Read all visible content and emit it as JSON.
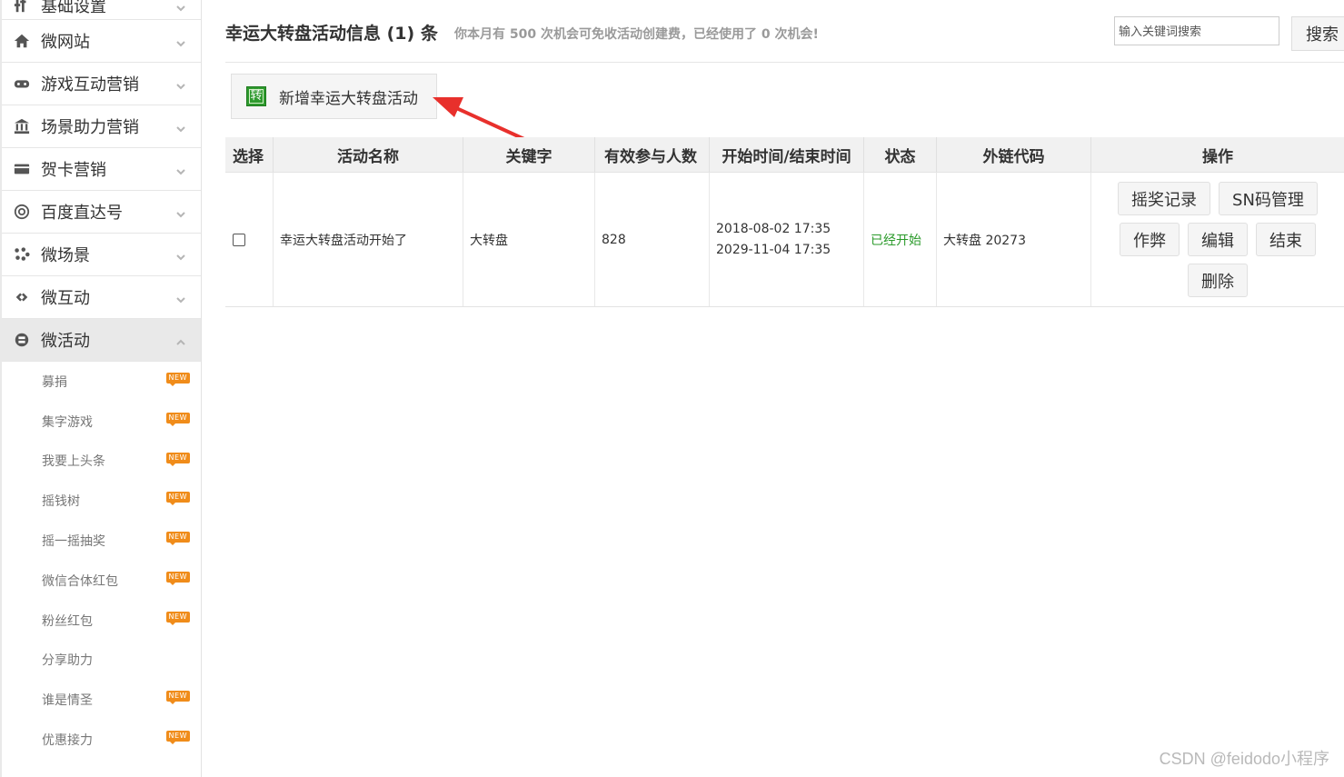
{
  "sidebar": {
    "groups": [
      {
        "label": "基础设置",
        "icon": "settings-icon"
      },
      {
        "label": "微网站",
        "icon": "home-icon"
      },
      {
        "label": "游戏互动营销",
        "icon": "gamepad-icon"
      },
      {
        "label": "场景助力营销",
        "icon": "bank-icon"
      },
      {
        "label": "贺卡营销",
        "icon": "card-icon"
      },
      {
        "label": "百度直达号",
        "icon": "at-icon"
      },
      {
        "label": "微场景",
        "icon": "scene-icon"
      },
      {
        "label": "微互动",
        "icon": "link-icon"
      },
      {
        "label": "微活动",
        "icon": "activity-icon"
      }
    ],
    "sub_items": [
      {
        "label": "募捐",
        "badge": "NEW"
      },
      {
        "label": "集字游戏",
        "badge": "NEW"
      },
      {
        "label": "我要上头条",
        "badge": "NEW"
      },
      {
        "label": "摇钱树",
        "badge": "NEW"
      },
      {
        "label": "摇一摇抽奖",
        "badge": "NEW"
      },
      {
        "label": "微信合体红包",
        "badge": "NEW"
      },
      {
        "label": "粉丝红包",
        "badge": "NEW"
      },
      {
        "label": "分享助力",
        "badge": ""
      },
      {
        "label": "谁是情圣",
        "badge": "NEW"
      },
      {
        "label": "优惠接力",
        "badge": "NEW"
      }
    ]
  },
  "header": {
    "title": "幸运大转盘活动信息 (1) 条",
    "note": "你本月有 500 次机会可免收活动创建费，已经使用了 0 次机会!",
    "search_placeholder": "输入关键词搜索",
    "search_label": "搜索"
  },
  "add_button": {
    "icon_text": "转",
    "label": "新增幸运大转盘活动"
  },
  "table": {
    "headers": [
      "选择",
      "活动名称",
      "关键字",
      "有效参与人数",
      "开始时间/结束时间",
      "状态",
      "外链代码",
      "操作"
    ],
    "rows": [
      {
        "name": "幸运大转盘活动开始了",
        "keyword": "大转盘",
        "participants": "828",
        "start": "2018-08-02 17:35",
        "end": "2029-11-04 17:35",
        "status": "已经开始",
        "link_code": "大转盘 20273",
        "actions": [
          "摇奖记录",
          "SN码管理",
          "作弊",
          "编辑",
          "结束",
          "删除"
        ]
      }
    ]
  },
  "colors": {
    "status_started": "#2a9a2a",
    "badge": "#f08c1a",
    "arrow": "#e8302c"
  },
  "watermark": "CSDN @feidodo小程序"
}
